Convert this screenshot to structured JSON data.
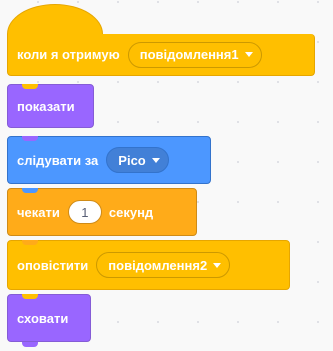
{
  "blocks": {
    "hat": {
      "label": "коли я отримую",
      "message": "повідомлення1"
    },
    "show": {
      "label": "показати"
    },
    "follow": {
      "label": "слідувати за",
      "target": "Рico"
    },
    "wait": {
      "label": "чекати",
      "value": "1",
      "unit": "секунд"
    },
    "broadcast": {
      "label": "оповістити",
      "message": "повідомлення2"
    },
    "hide": {
      "label": "сховати"
    }
  },
  "colors": {
    "events": "#ffbf00",
    "looks": "#9966ff",
    "motion": "#4c97ff",
    "control": "#ffab19",
    "workspace": "#f9f9f9"
  }
}
